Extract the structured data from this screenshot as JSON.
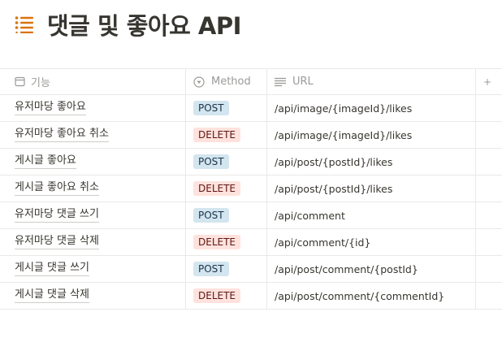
{
  "page": {
    "title": "댓글 및 좋아요 API",
    "title_icon": "list-icon",
    "accent_color": "#d9730d"
  },
  "table": {
    "headers": {
      "feature": "기능",
      "method": "Method",
      "url": "URL"
    },
    "header_icons": {
      "feature": "calendar-icon",
      "method": "select-icon",
      "url": "text-icon"
    },
    "rows": [
      {
        "feature": "유저마당 좋아요",
        "method": "POST",
        "url": "/api/image/{imageId}/likes"
      },
      {
        "feature": "유저마당 좋아요 취소",
        "method": "DELETE",
        "url": "/api/image/{imageId}/likes"
      },
      {
        "feature": "게시글 좋아요",
        "method": "POST",
        "url": "/api/post/{postId}/likes"
      },
      {
        "feature": "게시글 좋아요 취소",
        "method": "DELETE",
        "url": "/api/post/{postId}/likes"
      },
      {
        "feature": "유저마당 댓글 쓰기",
        "method": "POST",
        "url": "/api/comment"
      },
      {
        "feature": "유저마당 댓글 삭제",
        "method": "DELETE",
        "url": "/api/comment/{id}"
      },
      {
        "feature": "게시글 댓글 쓰기",
        "method": "POST",
        "url": "/api/post/comment/{postId}"
      },
      {
        "feature": "게시글 댓글 삭제",
        "method": "DELETE",
        "url": "/api/post/comment/{commentId}"
      }
    ],
    "method_colors": {
      "POST": "#d3e5ef",
      "DELETE": "#ffe2dd"
    }
  }
}
